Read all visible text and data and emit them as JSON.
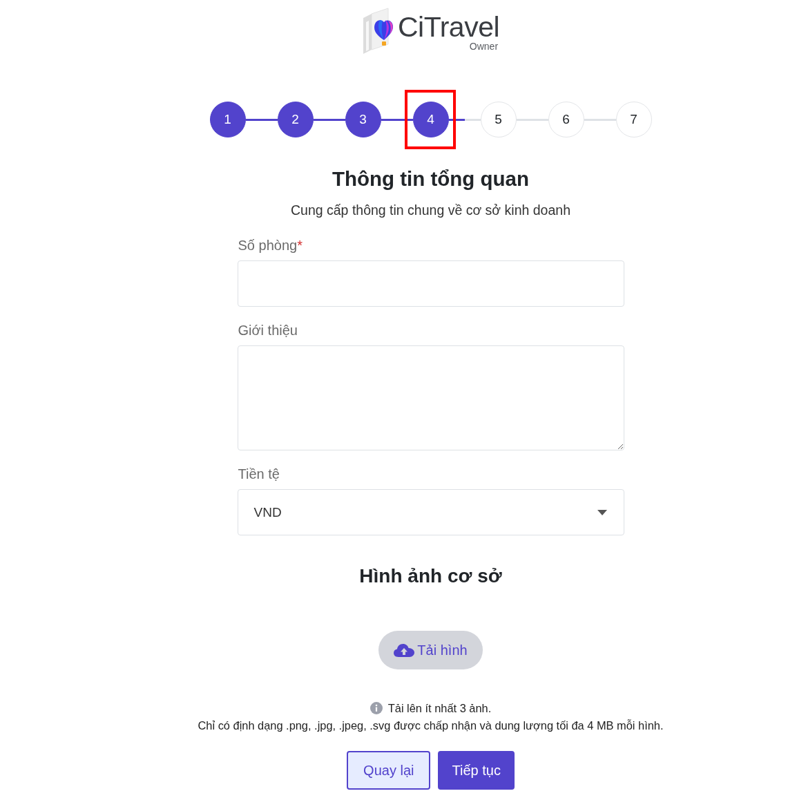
{
  "logo": {
    "name": "CiTravel",
    "subtitle": "Owner"
  },
  "stepper": {
    "steps": [
      {
        "label": "1",
        "completed": true,
        "highlighted": false
      },
      {
        "label": "2",
        "completed": true,
        "highlighted": false
      },
      {
        "label": "3",
        "completed": true,
        "highlighted": false
      },
      {
        "label": "4",
        "completed": true,
        "highlighted": true
      },
      {
        "label": "5",
        "completed": false,
        "highlighted": false
      },
      {
        "label": "6",
        "completed": false,
        "highlighted": false
      },
      {
        "label": "7",
        "completed": false,
        "highlighted": false
      }
    ],
    "connectors": [
      {
        "kind": "done"
      },
      {
        "kind": "done"
      },
      {
        "kind": "done"
      },
      {
        "kind": "partial",
        "level": 0.5
      },
      {
        "kind": "pending"
      },
      {
        "kind": "pending"
      }
    ]
  },
  "heading": {
    "title": "Thông tin tổng quan",
    "subtitle": "Cung cấp thông tin chung về cơ sở kinh doanh"
  },
  "form": {
    "fields": [
      {
        "kind": "input",
        "label": "Số phòng",
        "required_mark": "*"
      },
      {
        "kind": "textarea",
        "label": "Giới thiệu"
      },
      {
        "kind": "select",
        "label": "Tiền tệ",
        "value": "VND"
      }
    ]
  },
  "images": {
    "title": "Hình ảnh cơ sở",
    "upload_button": "Tải hình",
    "note": "Tải lên ít nhất 3 ảnh.",
    "requirements": "Chỉ có định dạng .png, .jpg, .jpeg, .svg được chấp nhận và dung lượng tối đa 4 MB mỗi hình."
  },
  "buttons": [
    {
      "kind": "secondary",
      "label": "Quay lại"
    },
    {
      "kind": "primary",
      "label": "Tiếp tục"
    }
  ]
}
